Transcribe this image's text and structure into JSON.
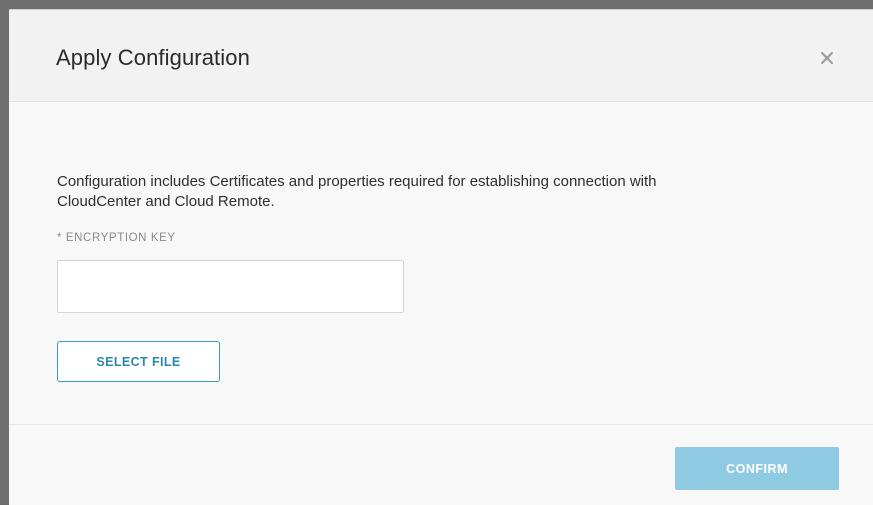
{
  "dialog": {
    "title": "Apply Configuration",
    "close_icon": "close-icon"
  },
  "body": {
    "description": "Configuration includes Certificates and properties required for establishing connection with CloudCenter and Cloud Remote.",
    "encryption_key": {
      "label": "* ENCRYPTION KEY",
      "value": "",
      "placeholder": ""
    },
    "select_file_label": "SELECT FILE"
  },
  "footer": {
    "confirm_label": "CONFIRM",
    "confirm_color": "#8fcae3"
  },
  "colors": {
    "accent": "#2a8aaa",
    "backdrop": "#6e6e6e"
  }
}
